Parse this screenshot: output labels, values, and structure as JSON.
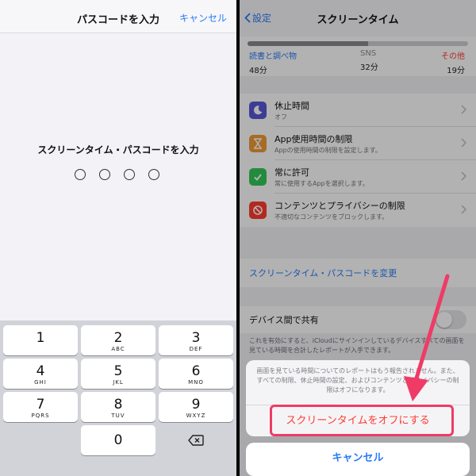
{
  "left": {
    "title": "パスコードを入力",
    "cancel": "キャンセル",
    "prompt": "スクリーンタイム・パスコードを入力",
    "passcode_length": 4,
    "keys": [
      {
        "num": "1",
        "sub": ""
      },
      {
        "num": "2",
        "sub": "ABC"
      },
      {
        "num": "3",
        "sub": "DEF"
      },
      {
        "num": "4",
        "sub": "GHI"
      },
      {
        "num": "5",
        "sub": "JKL"
      },
      {
        "num": "6",
        "sub": "MNO"
      },
      {
        "num": "7",
        "sub": "PQRS"
      },
      {
        "num": "8",
        "sub": "TUV"
      },
      {
        "num": "9",
        "sub": "WXYZ"
      },
      {
        "num": "0",
        "sub": ""
      }
    ]
  },
  "right": {
    "back": "設定",
    "title": "スクリーンタイム",
    "usage": [
      {
        "label": "読書と調べ物",
        "value": "48分",
        "color": "#2a7bf6"
      },
      {
        "label": "SNS",
        "value": "32分",
        "color": "#8e8e93"
      },
      {
        "label": "その他",
        "value": "19分",
        "color": "#ff3b30"
      }
    ],
    "rows": [
      {
        "title": "休止時間",
        "subtitle": "オフ",
        "icon": "moon-icon",
        "color": "#5856d6"
      },
      {
        "title": "App使用時間の制限",
        "subtitle": "Appの使用時間の制限を設定します。",
        "icon": "hourglass-icon",
        "color": "#f09a37"
      },
      {
        "title": "常に許可",
        "subtitle": "常に使用するAppを選択します。",
        "icon": "checkmark-icon",
        "color": "#34c759"
      },
      {
        "title": "コンテンツとプライバシーの制限",
        "subtitle": "不適切なコンテンツをブロックします。",
        "icon": "restrict-icon",
        "color": "#ff3b30"
      }
    ],
    "change_passcode": "スクリーンタイム・パスコードを変更",
    "share_label": "デバイス間で共有",
    "share_desc": "これを有効にすると、iCloudにサインインしているデバイスすべての画面を見ている時間を合計したレポートが入手できます。",
    "sheet_message": "画面を見ている時間についてのレポートはもう報告されません。また、すべての制限、休止時間の設定、およびコンテンツとプライバシーの制限はオフになります。",
    "sheet_action": "スクリーンタイムをオフにする",
    "sheet_cancel": "キャンセル",
    "highlight_color": "#ef3b66"
  }
}
